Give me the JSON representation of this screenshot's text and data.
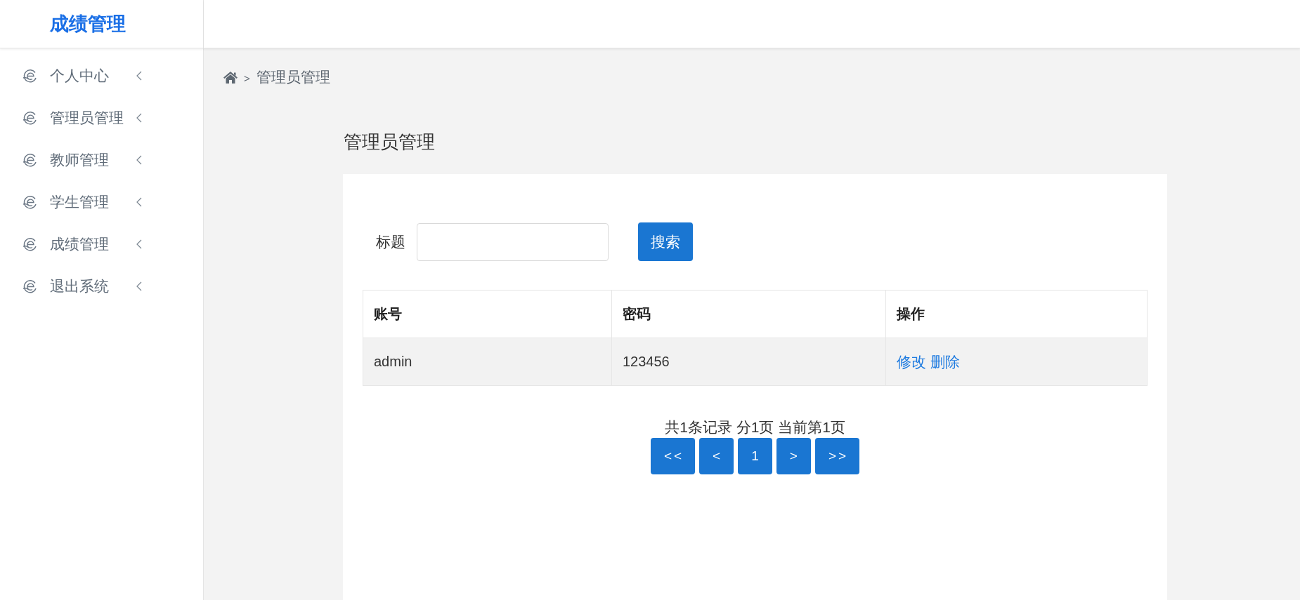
{
  "sidebar": {
    "title": "成绩管理",
    "items": [
      {
        "label": "个人中心",
        "expanded": false
      },
      {
        "label": "管理员管理",
        "expanded": false
      },
      {
        "label": "教师管理",
        "expanded": false
      },
      {
        "label": "学生管理",
        "expanded": false
      },
      {
        "label": "成绩管理",
        "expanded": false
      },
      {
        "label": "退出系统",
        "expanded": false
      }
    ]
  },
  "breadcrumb": {
    "separator": ">",
    "current": "管理员管理"
  },
  "page_title": "管理员管理",
  "search": {
    "label": "标题",
    "button": "搜索"
  },
  "table": {
    "columns": [
      "账号",
      "密码",
      "操作"
    ],
    "rows": [
      {
        "cells": [
          "admin",
          "123456"
        ],
        "actions": [
          "修改",
          "删除"
        ]
      }
    ]
  },
  "pagination": {
    "summary": "共1条记录 分1页 当前第1页",
    "buttons": [
      "<<",
      "<",
      "1",
      ">",
      ">>"
    ]
  }
}
